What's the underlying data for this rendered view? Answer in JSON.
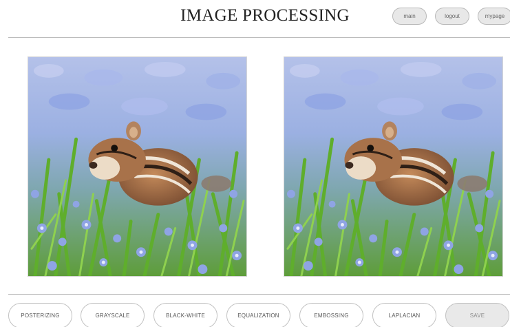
{
  "header": {
    "title": "IMAGE PROCESSING",
    "nav": {
      "main_label": "main",
      "logout_label": "logout",
      "mypage_label": "mypage"
    }
  },
  "images": {
    "original_alt": "chipmunk among blue flowers",
    "processed_alt": "chipmunk among blue flowers"
  },
  "operations": {
    "posterizing": "POSTERIZING",
    "grayscale": "GRAYSCALE",
    "black_white": "BLACK-WHITE",
    "equalization": "EQUALIZATION",
    "embossing": "EMBOSSING",
    "laplacian": "LAPLACIAN",
    "save": "SAVE"
  },
  "colors": {
    "flower_blue": "#8fa4e4",
    "leaf_green": "#5fae2c",
    "chipmunk_brown": "#a8724a",
    "button_fill": "#e8e8e8",
    "button_border": "#b9b9b9"
  }
}
